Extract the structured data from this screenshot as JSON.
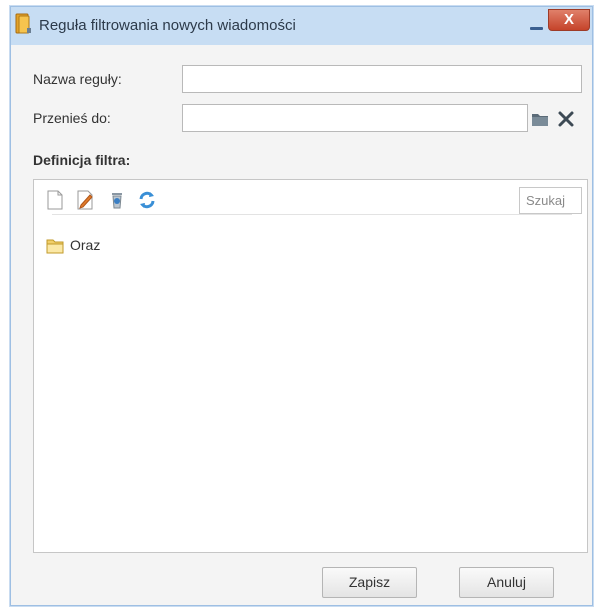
{
  "window": {
    "title": "Reguła filtrowania nowych wiadomości",
    "close_glyph": "X",
    "icon": "rule-book-icon"
  },
  "form": {
    "name_label": "Nazwa reguły:",
    "name_value": "",
    "move_label": "Przenieś do:",
    "move_value": "",
    "definition_label": "Definicja filtra:"
  },
  "filter": {
    "toolbar": [
      "new-doc-icon",
      "edit-icon",
      "delete-icon",
      "refresh-icon"
    ],
    "search_placeholder": "Szukaj",
    "tree": [
      {
        "label": "Oraz",
        "icon": "folder-icon"
      }
    ]
  },
  "buttons": {
    "save": "Zapisz",
    "cancel": "Anuluj"
  },
  "colors": {
    "titlebar": "#c7ddf3",
    "close": "#c5432a",
    "window_bg": "#f4f4f4"
  }
}
